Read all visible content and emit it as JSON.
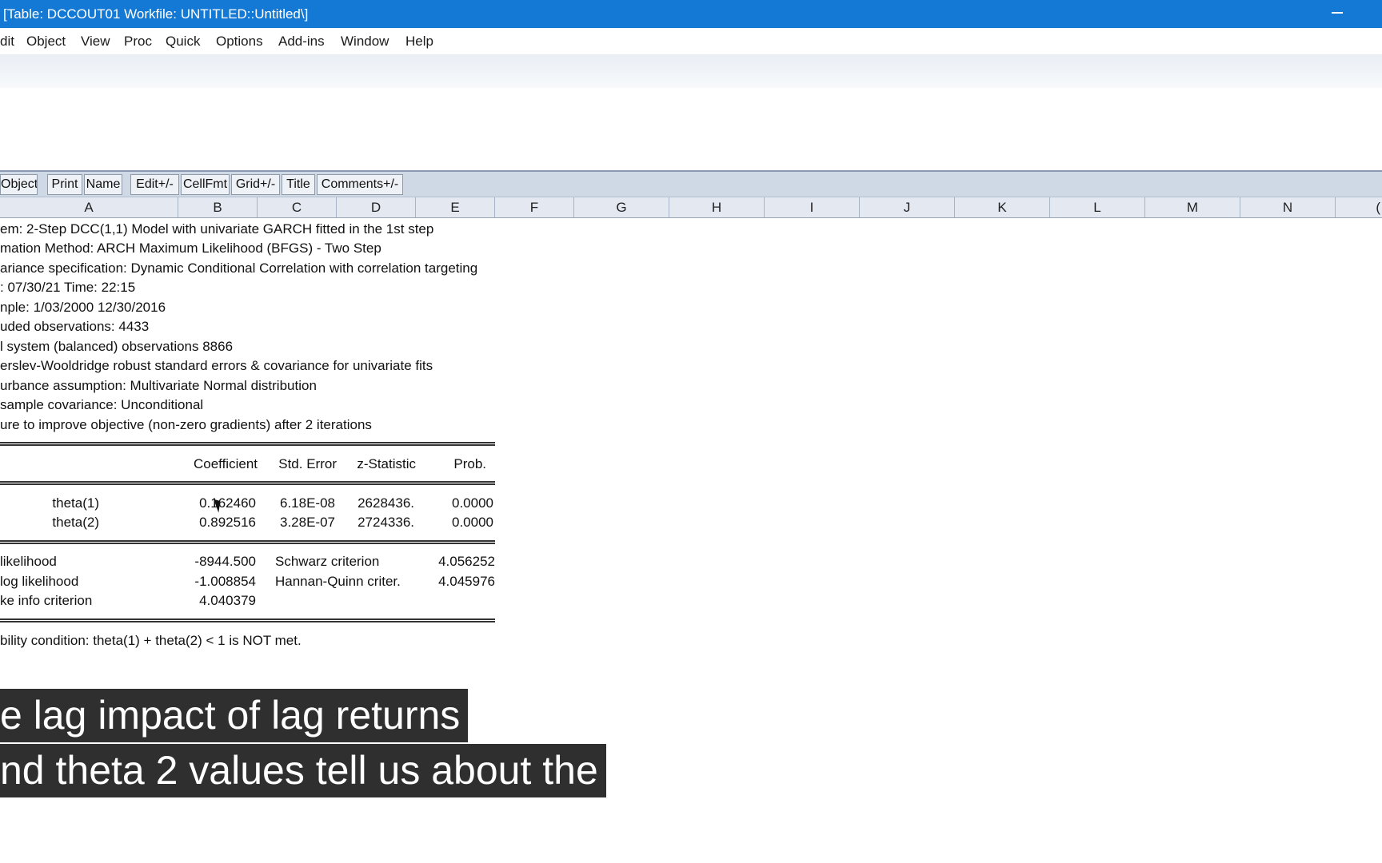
{
  "window": {
    "title": "[Table: DCCOUT01   Workfile: UNTITLED::Untitled\\]"
  },
  "menu": [
    "dit",
    "Object",
    "View",
    "Proc",
    "Quick",
    "Options",
    "Add-ins",
    "Window",
    "Help"
  ],
  "toolbar": [
    "Object",
    "Print",
    "Name",
    "Edit+/-",
    "CellFmt",
    "Grid+/-",
    "Title",
    "Comments+/-"
  ],
  "columns": [
    "A",
    "B",
    "C",
    "D",
    "E",
    "F",
    "G",
    "H",
    "I",
    "J",
    "K",
    "L",
    "M",
    "N",
    "("
  ],
  "header_lines": [
    "em: 2-Step DCC(1,1) Model with univariate GARCH fitted in the 1st step",
    "mation Method: ARCH Maximum Likelihood (BFGS) - Two Step",
    "ariance specification: Dynamic Conditional Correlation with correlation targeting",
    ": 07/30/21   Time: 22:15",
    "nple: 1/03/2000 12/30/2016",
    "uded observations: 4433",
    "l system (balanced) observations 8866",
    "erslev-Wooldridge robust standard errors & covariance for univariate fits",
    "urbance assumption: Multivariate Normal distribution",
    "sample covariance: Unconditional",
    "ure to improve objective (non-zero gradients) after 2 iterations"
  ],
  "coef_table": {
    "headers": [
      "Coefficient",
      "Std. Error",
      "z-Statistic",
      "Prob."
    ],
    "rows": [
      {
        "name": "theta(1)",
        "coef": "0.162460",
        "se": "6.18E-08",
        "z": "2628436.",
        "p": "0.0000"
      },
      {
        "name": "theta(2)",
        "coef": "0.892516",
        "se": "3.28E-07",
        "z": "2724336.",
        "p": "0.0000"
      }
    ]
  },
  "stats": [
    {
      "label": "likelihood",
      "value": "-8944.500",
      "label2": "Schwarz criterion",
      "value2": "4.056252"
    },
    {
      "label": "log likelihood",
      "value": "-1.008854",
      "label2": "Hannan-Quinn criter.",
      "value2": "4.045976"
    },
    {
      "label": "ke info criterion",
      "value": "4.040379",
      "label2": "",
      "value2": ""
    }
  ],
  "footer_note": "bility condition: theta(1) + theta(2) < 1 is NOT met.",
  "caption": {
    "line1": "e lag impact of lag returns",
    "line2": "nd theta 2 values tell us about the"
  }
}
